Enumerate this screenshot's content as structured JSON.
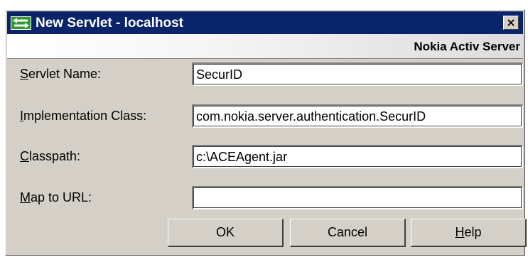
{
  "window": {
    "title": "New Servlet - localhost",
    "close_glyph": "×",
    "banner": "Nokia Activ Server"
  },
  "form": {
    "servlet_name": {
      "label_mnemonic": "S",
      "label_rest": "ervlet Name:",
      "value": "SecurID"
    },
    "implementation_class": {
      "label_mnemonic": "I",
      "label_rest": "mplementation Class:",
      "value": "com.nokia.server.authentication.SecurID"
    },
    "classpath": {
      "label_mnemonic": "C",
      "label_rest": "lasspath:",
      "value": "c:\\ACEAgent.jar"
    },
    "map_to_url": {
      "label_mnemonic": "M",
      "label_rest": "ap to URL:",
      "value": ""
    }
  },
  "buttons": {
    "ok": "OK",
    "cancel": "Cancel",
    "help_mnemonic": "H",
    "help_rest": "elp"
  },
  "icons": {
    "app_icon": "green-double-arrow-icon",
    "close_icon": "close-icon"
  },
  "colors": {
    "titlebar": "#0a246a",
    "dialog_face": "#d4d0c8",
    "app_icon_green": "#2e9a2e"
  }
}
